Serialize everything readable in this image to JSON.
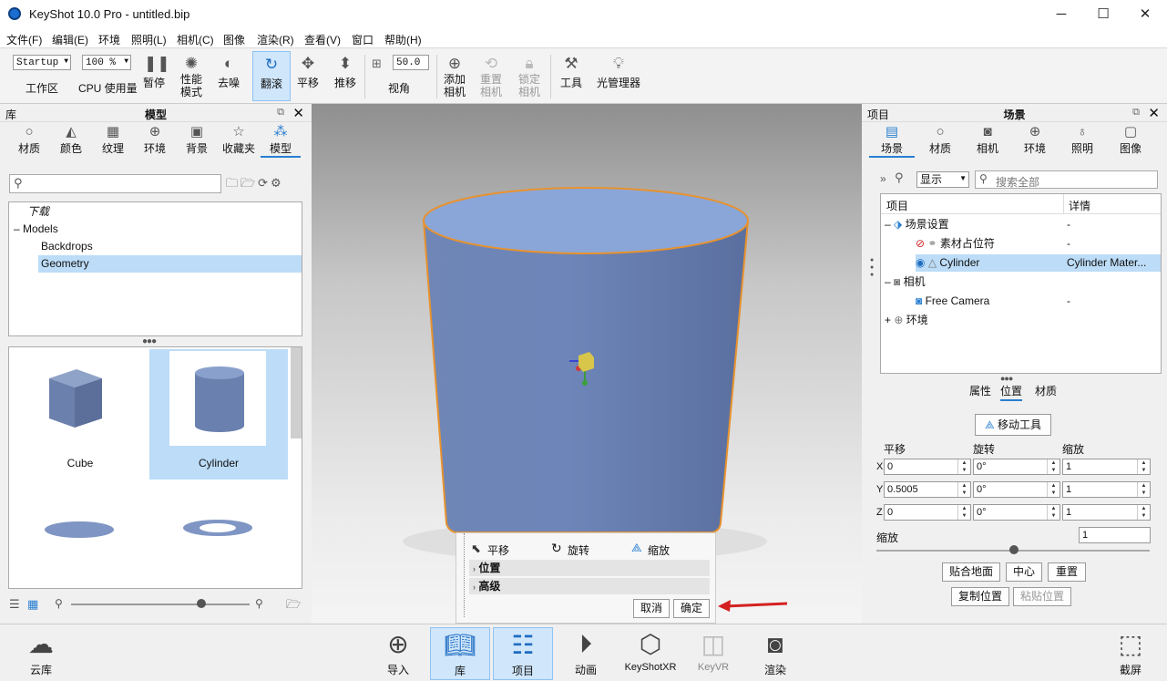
{
  "window": {
    "title": "KeyShot 10.0 Pro  - untitled.bip",
    "min": "─",
    "max": "☐",
    "close": "✕"
  },
  "menu": [
    "文件(F)",
    "编辑(E)",
    "环境",
    "照明(L)",
    "相机(C)",
    "图像",
    "渲染(R)",
    "查看(V)",
    "窗口",
    "帮助(H)"
  ],
  "toolbar": {
    "workspace_value": "Startup",
    "workspace_label": "工作区",
    "cpu_value": "100 %",
    "cpu_label": "CPU 使用量",
    "pause": "暂停",
    "perf1": "性能",
    "perf2": "模式",
    "denoise": "去噪",
    "tumble": "翻滚",
    "pan": "平移",
    "dolly": "推移",
    "fov_value": "50.0",
    "fov_label": "视角",
    "add_cam1": "添加",
    "add_cam2": "相机",
    "reset_cam1": "重置",
    "reset_cam2": "相机",
    "lock_cam1": "锁定",
    "lock_cam2": "相机",
    "tools": "工具",
    "light_mgr": "光管理器"
  },
  "library": {
    "header_left": "库",
    "header_title": "模型",
    "tabs": [
      "材质",
      "颜色",
      "纹理",
      "环境",
      "背景",
      "收藏夹",
      "模型"
    ],
    "search_placeholder": "",
    "tree": [
      "下载",
      "Models",
      "Backdrops",
      "Geometry"
    ],
    "thumbs": [
      "Cube",
      "Cylinder"
    ]
  },
  "gizmo_panel": {
    "move": "平移",
    "rotate": "旋转",
    "scale": "缩放",
    "position": "位置",
    "advanced": "高级",
    "cancel": "取消",
    "ok": "确定"
  },
  "project": {
    "header_left": "项目",
    "header_title": "场景",
    "tabs": [
      "场景",
      "材质",
      "相机",
      "环境",
      "照明",
      "图像"
    ],
    "show_label": "显示",
    "search_placeholder": "搜索全部",
    "col_item": "项目",
    "col_detail": "详情",
    "tree": [
      {
        "name": "场景设置",
        "detail": "-"
      },
      {
        "name": "素材占位符",
        "detail": "-"
      },
      {
        "name": "Cylinder",
        "detail": "Cylinder Mater..."
      },
      {
        "name": "相机",
        "detail": ""
      },
      {
        "name": "Free Camera",
        "detail": "-"
      },
      {
        "name": "环境",
        "detail": ""
      }
    ],
    "subtabs": [
      "属性",
      "位置",
      "材质"
    ],
    "move_tool": "移动工具",
    "translate": "平移",
    "rotate": "旋转",
    "scale": "缩放",
    "rows": [
      {
        "axis": "X",
        "t": "0",
        "r": "0°",
        "s": "1"
      },
      {
        "axis": "Y",
        "t": "0.5005",
        "r": "0°",
        "s": "1"
      },
      {
        "axis": "Z",
        "t": "0",
        "r": "0°",
        "s": "1"
      }
    ],
    "uniform_scale_label": "缩放",
    "uniform_scale_value": "1",
    "snap_ground": "贴合地面",
    "center": "中心",
    "reset": "重置",
    "copy_pos": "复制位置",
    "paste_pos": "粘贴位置"
  },
  "bottom": {
    "cloud": "云库",
    "import": "导入",
    "library": "库",
    "project": "项目",
    "animation": "动画",
    "keyshotxr": "KeyShotXR",
    "keyvr": "KeyVR",
    "render": "渲染",
    "screenshot": "截屏"
  }
}
